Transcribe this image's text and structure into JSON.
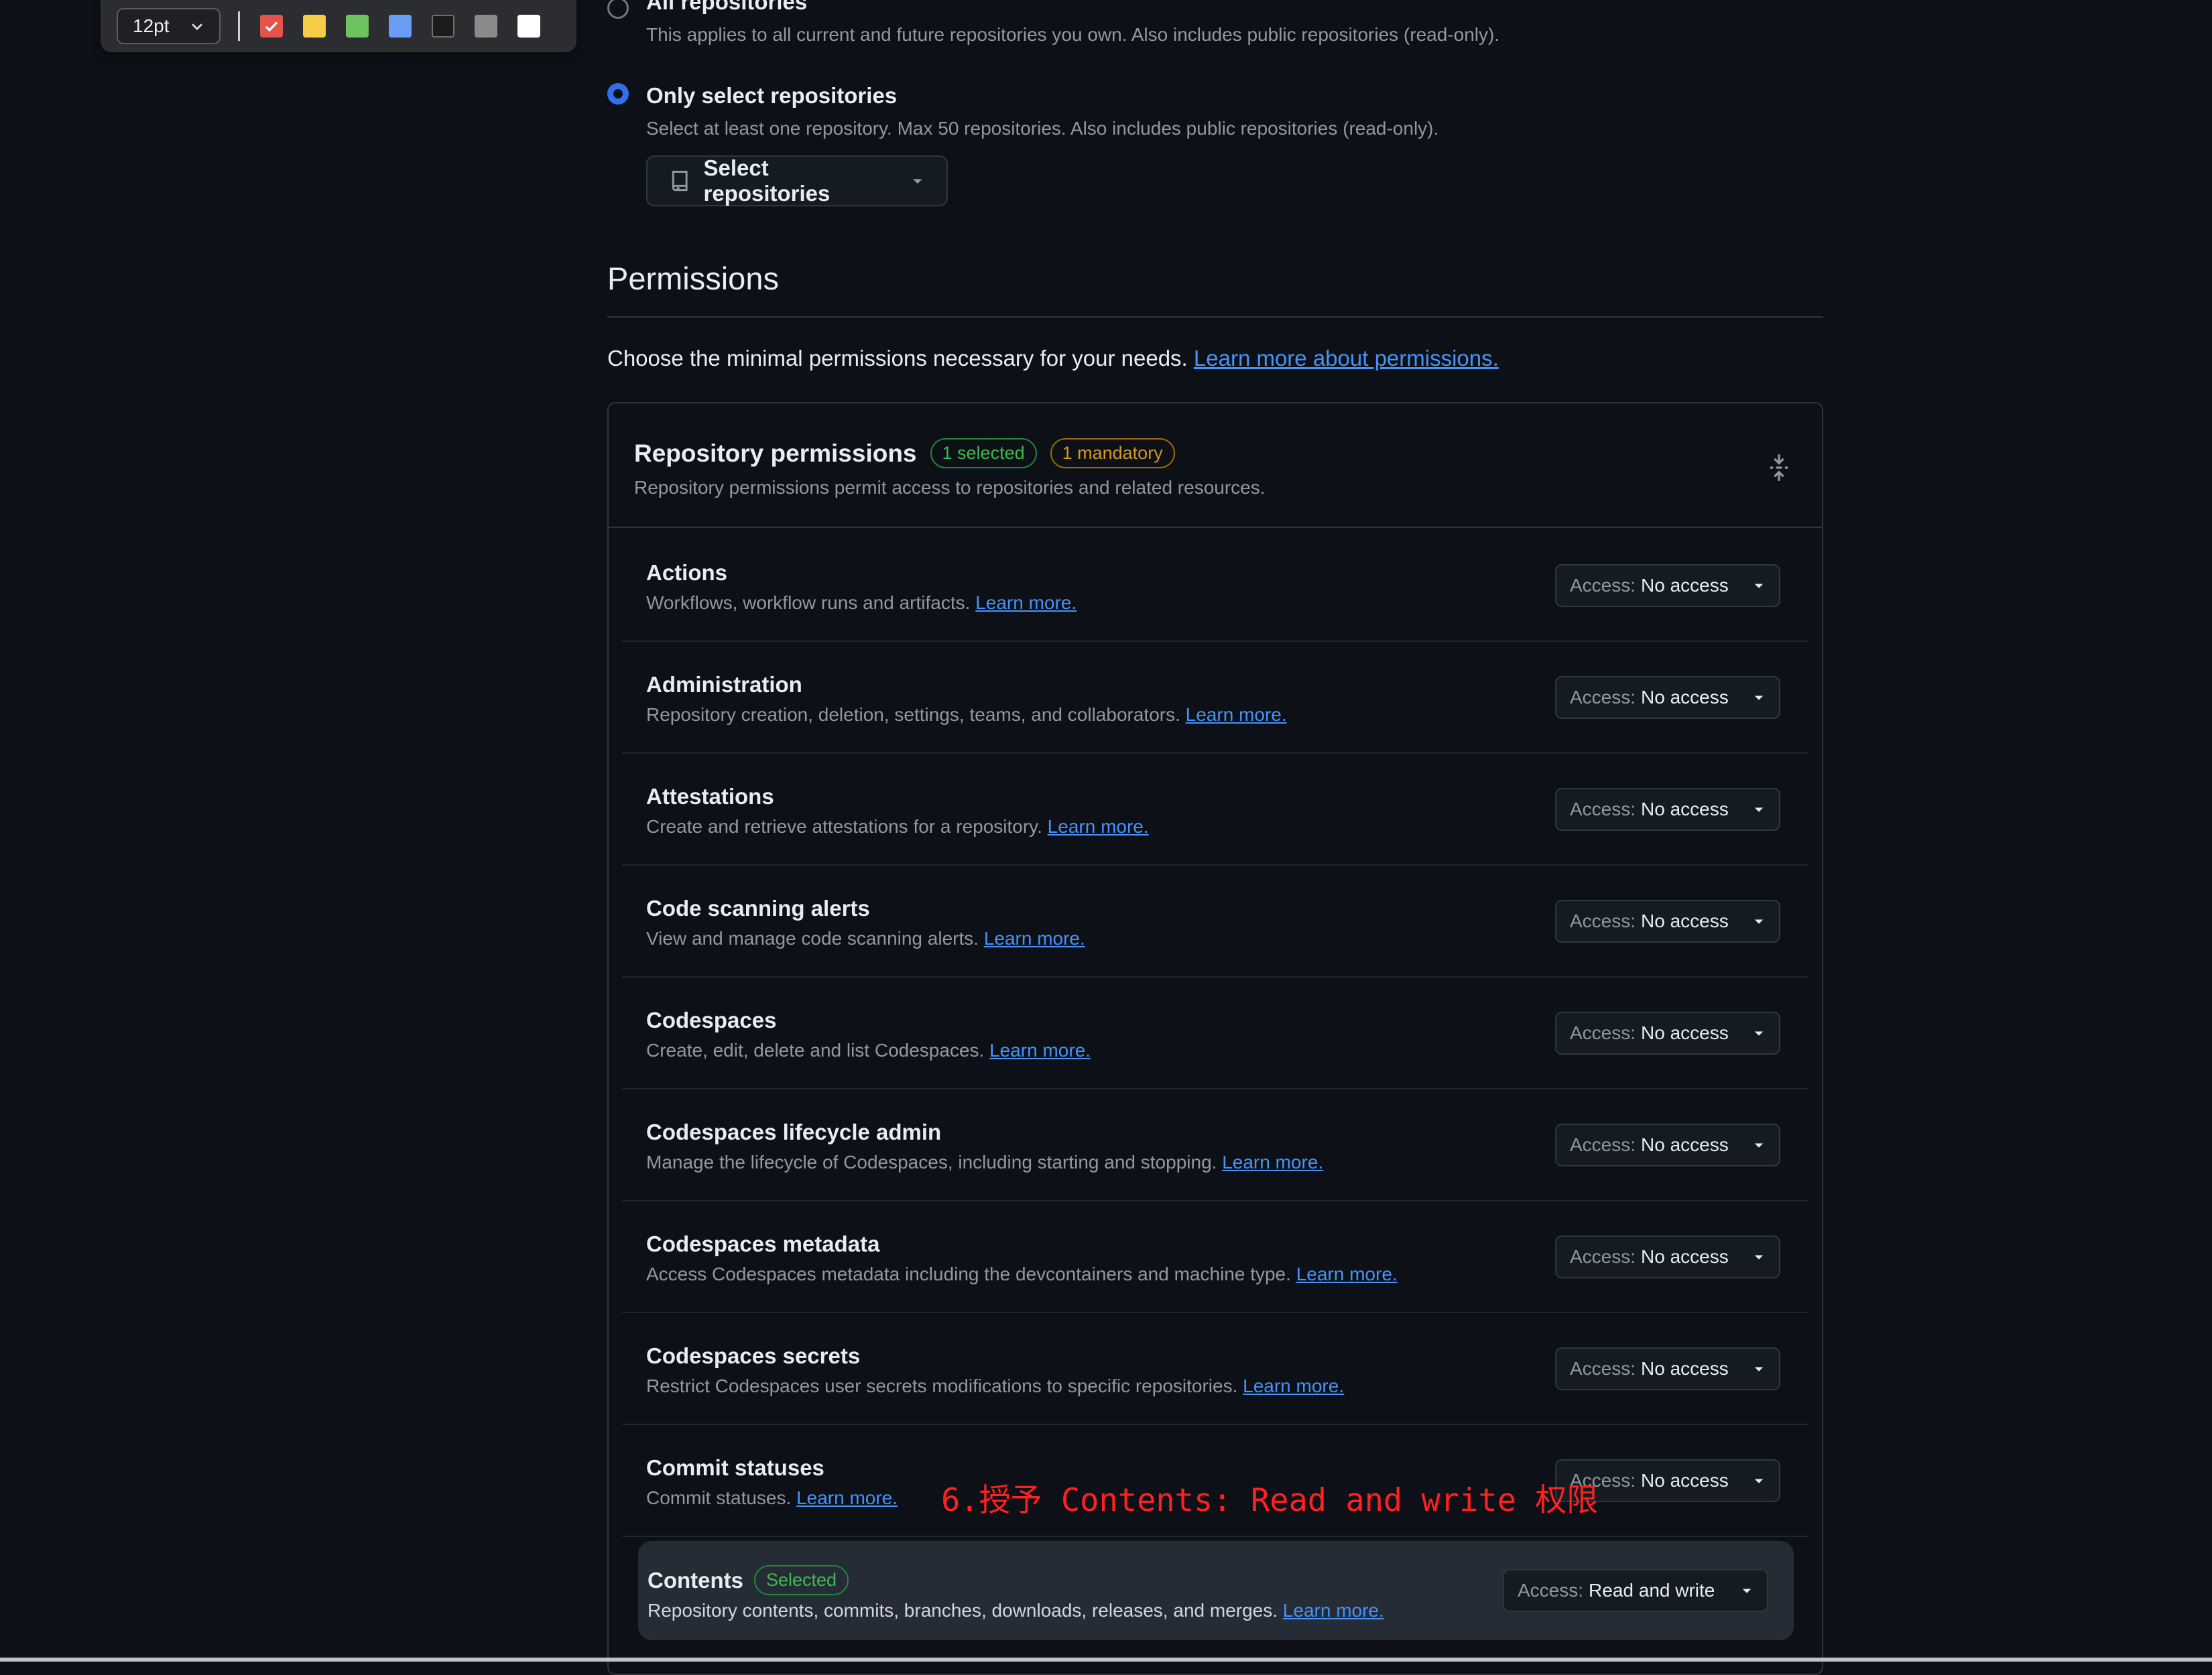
{
  "toolbar": {
    "font_size": "12pt",
    "swatches": [
      {
        "name": "red",
        "color": "#e5534b",
        "selected": true
      },
      {
        "name": "yellow",
        "color": "#f5cd47"
      },
      {
        "name": "green",
        "color": "#6ec25f"
      },
      {
        "name": "blue",
        "color": "#6b9cf5"
      },
      {
        "name": "black",
        "color": "#1c1c1c"
      },
      {
        "name": "gray",
        "color": "#8a8a8a"
      },
      {
        "name": "white",
        "color": "#ffffff"
      }
    ]
  },
  "repository_access": {
    "all_label": "All repositories",
    "all_desc": "This applies to all current and future repositories you own. Also includes public repositories (read-only).",
    "select_label": "Only select repositories",
    "select_desc": "Select at least one repository. Max 50 repositories. Also includes public repositories (read-only).",
    "select_button": "Select repositories"
  },
  "permissions": {
    "heading": "Permissions",
    "intro": "Choose the minimal permissions necessary for your needs.",
    "intro_link": "Learn more about permissions.",
    "box_title": "Repository permissions",
    "badge_selected": "1 selected",
    "badge_mandatory": "1 mandatory",
    "box_desc": "Repository permissions permit access to repositories and related resources.",
    "access_label": "Access:",
    "learn_more": "Learn more.",
    "rows": [
      {
        "name": "Actions",
        "desc": "Workflows, workflow runs and artifacts.",
        "access": "No access"
      },
      {
        "name": "Administration",
        "desc": "Repository creation, deletion, settings, teams, and collaborators.",
        "access": "No access"
      },
      {
        "name": "Attestations",
        "desc": "Create and retrieve attestations for a repository.",
        "access": "No access"
      },
      {
        "name": "Code scanning alerts",
        "desc": "View and manage code scanning alerts.",
        "access": "No access"
      },
      {
        "name": "Codespaces",
        "desc": "Create, edit, delete and list Codespaces.",
        "access": "No access"
      },
      {
        "name": "Codespaces lifecycle admin",
        "desc": "Manage the lifecycle of Codespaces, including starting and stopping.",
        "access": "No access"
      },
      {
        "name": "Codespaces metadata",
        "desc": "Access Codespaces metadata including the devcontainers and machine type.",
        "access": "No access"
      },
      {
        "name": "Codespaces secrets",
        "desc": "Restrict Codespaces user secrets modifications to specific repositories.",
        "access": "No access"
      },
      {
        "name": "Commit statuses",
        "desc": "Commit statuses.",
        "access": "No access"
      }
    ],
    "contents": {
      "name": "Contents",
      "badge": "Selected",
      "desc": "Repository contents, commits, branches, downloads, releases, and merges.",
      "access": "Read and write"
    }
  },
  "annotation_text": "6.授予 Contents: Read and write 权限"
}
